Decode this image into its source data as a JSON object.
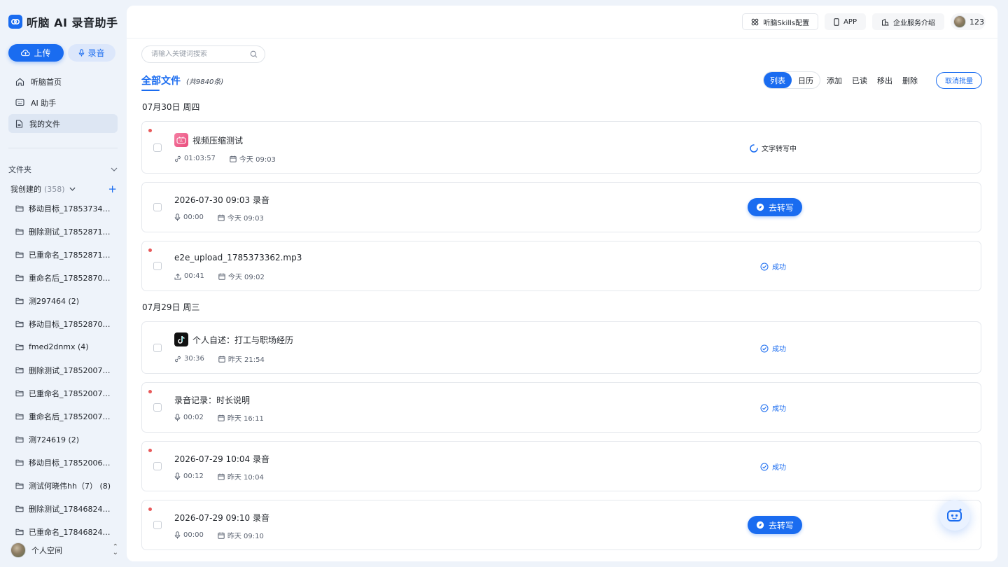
{
  "brand": {
    "title": "听脑 AI 录音助手",
    "logo": "brand-logo-icon",
    "accent": "#1a6cf0"
  },
  "sidebar": {
    "upload_label": "上传",
    "record_label": "录音",
    "nav": [
      {
        "label": "听脑首页",
        "icon": "home-icon"
      },
      {
        "label": "AI 助手",
        "icon": "keyboard-icon"
      },
      {
        "label": "我的文件",
        "icon": "file-icon",
        "active": true
      }
    ],
    "folders_label": "文件夹",
    "created_label": "我创建的",
    "created_count": "(358)",
    "folders": [
      "移动目标_1785373497 ...",
      "删除测试_1785287120 ...",
      "已重命名_1785287107 (...",
      "重命名后_1785287096 ...",
      "测297464 (2)",
      "移动目标_1785287046 ...",
      "fmed2dnmx (4)",
      "删除测试_1785200743 ...",
      "已重命名_1785200729 ...",
      "重命名后_1785200720 ...",
      "测724619 (2)",
      "移动目标_1785200673 ...",
      "测试何晓伟hh（7） (8)",
      "删除测试_1784682455 ...",
      "已重命名_1784682438 ..."
    ],
    "space_label": "个人空间"
  },
  "topbar": {
    "skills_label": "听脑Skills配置",
    "app_label": "APP",
    "enterprise_label": "企业服务介绍",
    "user_name": "123"
  },
  "search": {
    "placeholder": "请输入关键词搜索"
  },
  "files": {
    "title": "全部文件",
    "total": "(共9840条)",
    "view_list": "列表",
    "view_calendar": "日历",
    "actions": [
      "添加",
      "已读",
      "移出",
      "删除"
    ],
    "cancel_batch": "取消批量",
    "groups": [
      {
        "date": "07月30日 周四",
        "items": [
          {
            "title": "视频压缩测试",
            "app_icon": "bilibili-icon",
            "duration": "01:03:57",
            "duration_icon": "link-icon",
            "time": "今天 09:03",
            "status": "文字转写中",
            "status_type": "progress",
            "unread": true
          },
          {
            "title": "2026-07-30 09:03 录音",
            "duration": "00:00",
            "duration_icon": "mic-icon",
            "time": "今天 09:03",
            "status": "去转写",
            "status_type": "button",
            "unread": false
          },
          {
            "title": "e2e_upload_1785373362.mp3",
            "duration": "00:41",
            "duration_icon": "upload-icon",
            "time": "今天 09:02",
            "status": "成功",
            "status_type": "success",
            "unread": true
          }
        ]
      },
      {
        "date": "07月29日 周三",
        "items": [
          {
            "title": "个人自述：打工与职场经历",
            "app_icon": "tiktok-icon",
            "duration": "30:36",
            "duration_icon": "link-icon",
            "time": "昨天 21:54",
            "status": "成功",
            "status_type": "success",
            "unread": false
          },
          {
            "title": "录音记录：时长说明",
            "duration": "00:02",
            "duration_icon": "mic-icon",
            "time": "昨天 16:11",
            "status": "成功",
            "status_type": "success",
            "unread": true
          },
          {
            "title": "2026-07-29 10:04 录音",
            "duration": "00:12",
            "duration_icon": "mic-icon",
            "time": "昨天 10:04",
            "status": "成功",
            "status_type": "success",
            "unread": true
          },
          {
            "title": "2026-07-29 09:10 录音",
            "duration": "00:00",
            "duration_icon": "mic-icon",
            "time": "昨天 09:10",
            "status": "去转写",
            "status_type": "button",
            "unread": true
          }
        ]
      }
    ]
  }
}
